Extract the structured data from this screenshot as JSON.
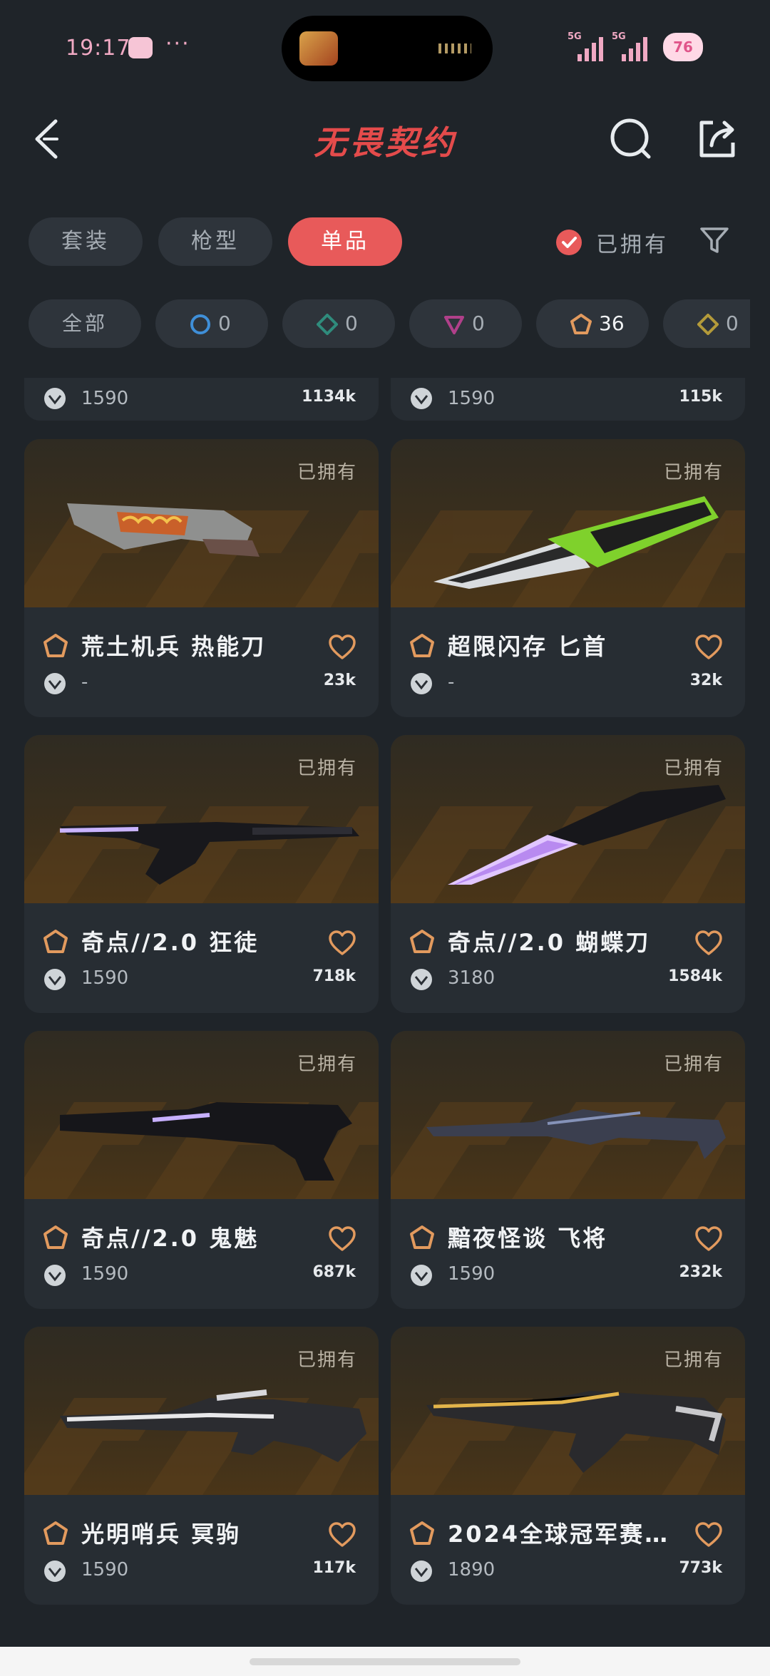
{
  "status_bar": {
    "time": "19:17",
    "dots": "···",
    "net1": "5G",
    "net2": "5G",
    "battery": "76"
  },
  "nav": {
    "title": "无畏契约"
  },
  "tabs": [
    {
      "label": "套装",
      "active": false
    },
    {
      "label": "枪型",
      "active": false
    },
    {
      "label": "单品",
      "active": true
    }
  ],
  "owned_filter": {
    "label": "已拥有",
    "checked": true
  },
  "rarity_chips": [
    {
      "label": "全部"
    },
    {
      "count": "0",
      "color": "#3f8fd8"
    },
    {
      "count": "0",
      "color": "#2f8b7c"
    },
    {
      "count": "0",
      "color": "#b0408a"
    },
    {
      "count": "36",
      "color": "#e29a5e"
    },
    {
      "count": "0",
      "color": "#b39a3a"
    }
  ],
  "partial_row": [
    {
      "price": "1590",
      "likes": "1134k"
    },
    {
      "price": "1590",
      "likes": "115k"
    }
  ],
  "cards": [
    {
      "owned": "已拥有",
      "name": "荒土机兵 热能刀",
      "price": "-",
      "likes": "23k",
      "weapon": "heat-knife"
    },
    {
      "owned": "已拥有",
      "name": "超限闪存 匕首",
      "price": "-",
      "likes": "32k",
      "weapon": "green-dagger"
    },
    {
      "owned": "已拥有",
      "name": "奇点//2.0 狂徒",
      "price": "1590",
      "likes": "718k",
      "weapon": "singularity-vandal"
    },
    {
      "owned": "已拥有",
      "name": "奇点//2.0 蝴蝶刀",
      "price": "3180",
      "likes": "1584k",
      "weapon": "singularity-knife"
    },
    {
      "owned": "已拥有",
      "name": "奇点//2.0 鬼魅",
      "price": "1590",
      "likes": "687k",
      "weapon": "singularity-ghost"
    },
    {
      "owned": "已拥有",
      "name": "黯夜怪谈 飞将",
      "price": "1590",
      "likes": "232k",
      "weapon": "dark-operator"
    },
    {
      "owned": "已拥有",
      "name": "光明哨兵 冥驹",
      "price": "1590",
      "likes": "117k",
      "weapon": "sentinel-marshal"
    },
    {
      "owned": "已拥有",
      "name": "2024全球冠军赛…",
      "price": "1890",
      "likes": "773k",
      "weapon": "champions-rifle"
    }
  ]
}
